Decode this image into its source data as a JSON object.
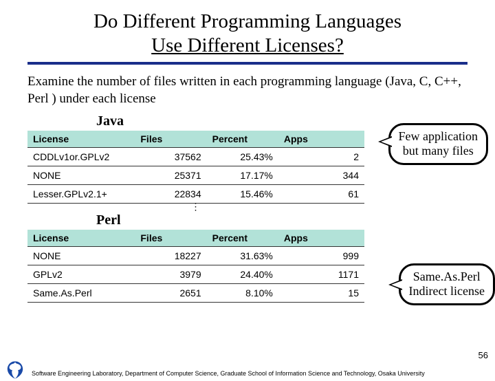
{
  "title_line1": "Do Different Programming Languages",
  "title_line2": "Use Different Licenses?",
  "description": "Examine the number of files written in each programming language (Java, C, C++, Perl ) under each license",
  "tables": {
    "java": {
      "label": "Java",
      "headers": {
        "license": "License",
        "files": "Files",
        "percent": "Percent",
        "apps": "Apps"
      },
      "rows": [
        {
          "license": "CDDLv1or.GPLv2",
          "files": "37562",
          "percent": "25.43%",
          "apps": "2"
        },
        {
          "license": "NONE",
          "files": "25371",
          "percent": "17.17%",
          "apps": "344"
        },
        {
          "license": "Lesser.GPLv2.1+",
          "files": "22834",
          "percent": "15.46%",
          "apps": "61"
        }
      ]
    },
    "perl": {
      "label": "Perl",
      "headers": {
        "license": "License",
        "files": "Files",
        "percent": "Percent",
        "apps": "Apps"
      },
      "rows": [
        {
          "license": "NONE",
          "files": "18227",
          "percent": "31.63%",
          "apps": "999"
        },
        {
          "license": "GPLv2",
          "files": "3979",
          "percent": "24.40%",
          "apps": "1171"
        },
        {
          "license": "Same.As.Perl",
          "files": "2651",
          "percent": "8.10%",
          "apps": "15"
        }
      ]
    }
  },
  "callouts": {
    "c1_l1": "Few application",
    "c1_l2": "but many files",
    "c2_l1": "Same.As.Perl",
    "c2_l2": "Indirect license"
  },
  "pagenum": "56",
  "footer": "Software Engineering Laboratory, Department of Computer Science, Graduate School of Information Science and Technology, Osaka University"
}
